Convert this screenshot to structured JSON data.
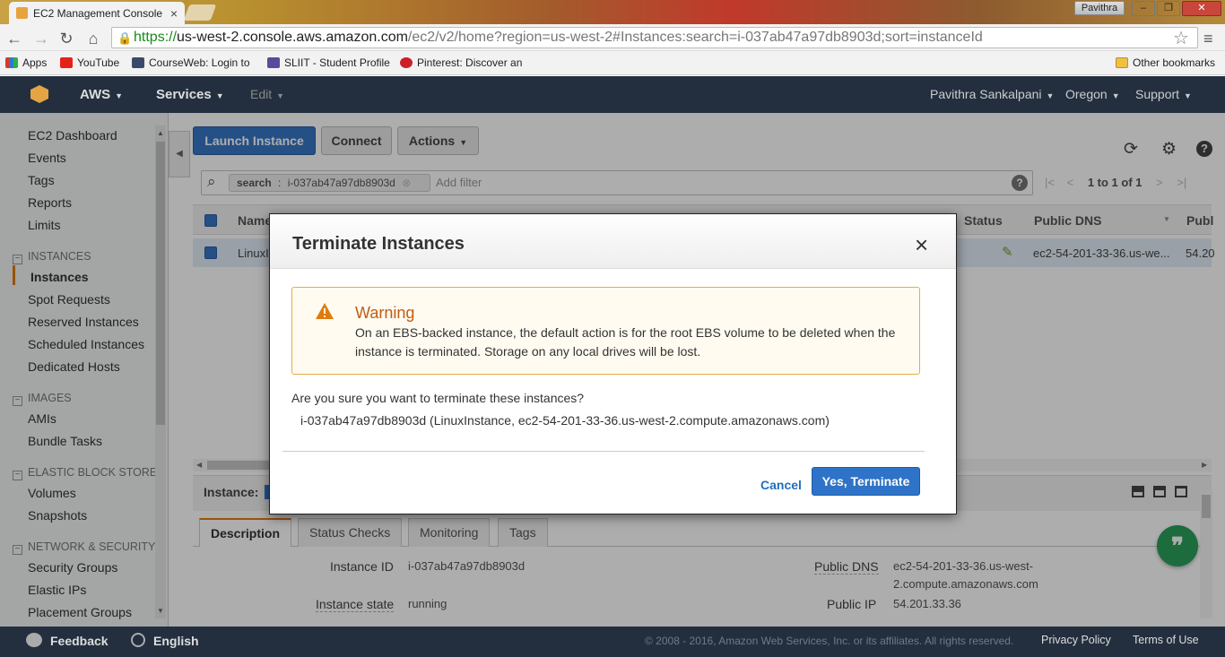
{
  "browser": {
    "tab_title": "EC2 Management Console",
    "tab_close": "×",
    "user_badge": "Pavithra",
    "url_scheme": "https://",
    "url_host": "us-west-2.console.aws.amazon.com",
    "url_path": "/ec2/v2/home?region=us-west-2#Instances:search=i-037ab47a97db8903d;sort=instanceId",
    "bookmarks": [
      {
        "label": "Apps",
        "icon": "apps-grid-icon",
        "color": "#d23b2b"
      },
      {
        "label": "YouTube",
        "icon": "youtube-icon",
        "color": "#e62117"
      },
      {
        "label": "CourseWeb: Login to",
        "icon": "courseweb-icon",
        "color": "#3a4a6b"
      },
      {
        "label": "SLIIT - Student Profile",
        "icon": "sliit-icon",
        "color": "#5b4a9b"
      },
      {
        "label": "Pinterest: Discover an",
        "icon": "pinterest-icon",
        "color": "#cb2027"
      }
    ],
    "other_bookmarks": "Other bookmarks"
  },
  "aws_header": {
    "brand": "AWS",
    "services": "Services",
    "edit": "Edit",
    "user": "Pavithra Sankalpani",
    "region": "Oregon",
    "support": "Support"
  },
  "sidebar": {
    "top_links": [
      "EC2 Dashboard",
      "Events",
      "Tags",
      "Reports",
      "Limits"
    ],
    "instances_section": "INSTANCES",
    "instances_links": [
      "Instances",
      "Spot Requests",
      "Reserved Instances",
      "Scheduled Instances",
      "Dedicated Hosts"
    ],
    "images_section": "IMAGES",
    "images_links": [
      "AMIs",
      "Bundle Tasks"
    ],
    "ebs_section": "ELASTIC BLOCK STORE",
    "ebs_links": [
      "Volumes",
      "Snapshots"
    ],
    "netsec_section": "NETWORK & SECURITY",
    "netsec_links": [
      "Security Groups",
      "Elastic IPs",
      "Placement Groups"
    ]
  },
  "toolbar": {
    "launch": "Launch Instance",
    "connect": "Connect",
    "actions": "Actions"
  },
  "filter": {
    "chip_key": "search",
    "chip_sep": ":",
    "chip_value": "i-037ab47a97db8903d",
    "add_filter": "Add filter",
    "pager": "1 to 1 of 1"
  },
  "table": {
    "col_name": "Name",
    "col_status": "Status",
    "col_public_dns": "Public DNS",
    "col_public_ip": "Publ",
    "row_name": "LinuxI",
    "row_dns": "ec2-54-201-33-36.us-we...",
    "row_ip": "54.20"
  },
  "details": {
    "instance_label": "Instance:",
    "tabs": [
      "Description",
      "Status Checks",
      "Monitoring",
      "Tags"
    ],
    "instance_id_label": "Instance ID",
    "instance_id": "i-037ab47a97db8903d",
    "instance_state_label": "Instance state",
    "instance_state": "running",
    "public_dns_label": "Public DNS",
    "public_dns_line1": "ec2-54-201-33-36.us-west-",
    "public_dns_line2": "2.compute.amazonaws.com",
    "public_ip_label": "Public IP",
    "public_ip": "54.201.33.36"
  },
  "modal": {
    "title": "Terminate Instances",
    "close": "×",
    "warning_title": "Warning",
    "warning_text": "On an EBS-backed instance, the default action is for the root EBS volume to be deleted when the instance is terminated. Storage on any local drives will be lost.",
    "question": "Are you sure you want to terminate these instances?",
    "instance_line": "i-037ab47a97db8903d (LinuxInstance, ec2-54-201-33-36.us-west-2.compute.amazonaws.com)",
    "cancel": "Cancel",
    "confirm": "Yes, Terminate"
  },
  "footer": {
    "feedback": "Feedback",
    "language": "English",
    "copyright": "© 2008 - 2016, Amazon Web Services, Inc. or its affiliates. All rights reserved.",
    "privacy": "Privacy Policy",
    "terms": "Terms of Use"
  },
  "colors": {
    "aws_header_bg": "#232f3e",
    "primary_button": "#3677c6",
    "warning_border": "#e4ad4a",
    "warning_title": "#c35b10",
    "accent_orange": "#e47911"
  }
}
